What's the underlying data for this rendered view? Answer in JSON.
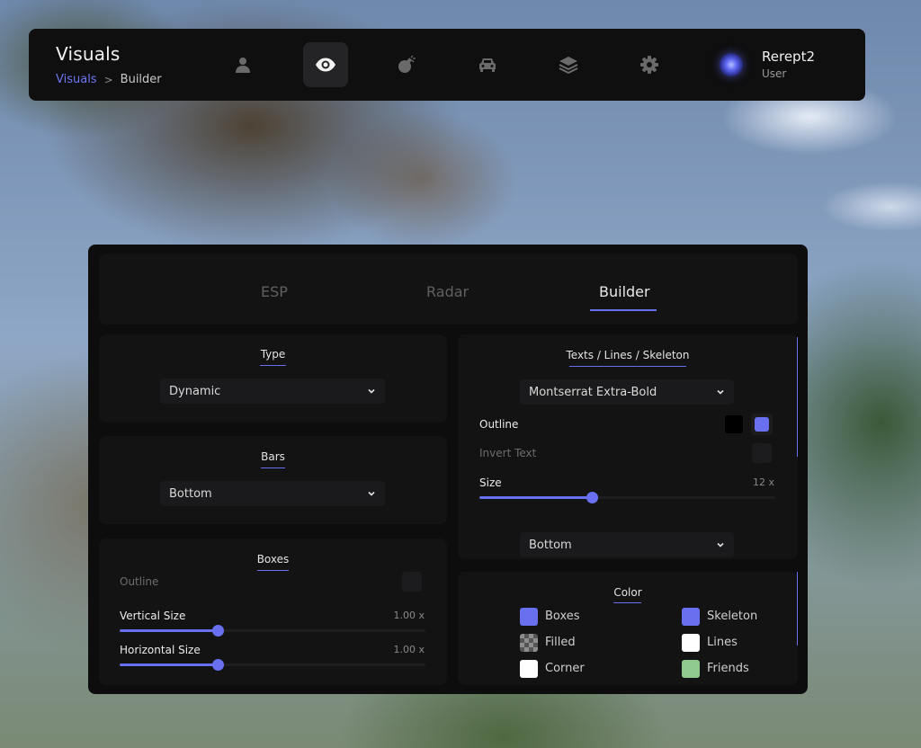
{
  "header": {
    "title": "Visuals",
    "breadcrumb": {
      "parent": "Visuals",
      "separator": ">",
      "current": "Builder"
    },
    "nav": [
      {
        "icon": "user-icon",
        "active": false
      },
      {
        "icon": "eye-icon",
        "active": true
      },
      {
        "icon": "bomb-icon",
        "active": false
      },
      {
        "icon": "car-icon",
        "active": false
      },
      {
        "icon": "layers-icon",
        "active": false
      },
      {
        "icon": "gear-icon",
        "active": false
      }
    ],
    "user": {
      "name": "Rerept2",
      "role": "User"
    }
  },
  "tabs": [
    {
      "label": "ESP",
      "active": false
    },
    {
      "label": "Radar",
      "active": false
    },
    {
      "label": "Builder",
      "active": true
    }
  ],
  "accent_color": "#6870f0",
  "type_card": {
    "title": "Type",
    "value": "Dynamic"
  },
  "bars_card": {
    "title": "Bars",
    "value": "Bottom"
  },
  "boxes_card": {
    "title": "Boxes",
    "outline_label": "Outline",
    "outline_enabled": false,
    "vertical_label": "Vertical Size",
    "vertical_value": "1.00 x",
    "vertical_fraction": 0.32,
    "horizontal_label": "Horizontal Size",
    "horizontal_value": "1.00 x",
    "horizontal_fraction": 0.32
  },
  "texts_card": {
    "title": "Texts / Lines / Skeleton",
    "font": "Montserrat Extra-Bold",
    "outline_label": "Outline",
    "outline_colors": [
      "#000000",
      "#6870f0"
    ],
    "invert_label": "Invert Text",
    "invert_enabled": false,
    "size_label": "Size",
    "size_value": "12 x",
    "size_fraction": 0.38,
    "position": "Bottom"
  },
  "color_card": {
    "title": "Color",
    "items": [
      {
        "label": "Boxes",
        "color": "#6870f0"
      },
      {
        "label": "Skeleton",
        "color": "#6870f0"
      },
      {
        "label": "Filled",
        "color": "checker"
      },
      {
        "label": "Lines",
        "color": "#ffffff"
      },
      {
        "label": "Corner",
        "color": "#ffffff"
      },
      {
        "label": "Friends",
        "color": "#8fc98f"
      }
    ]
  }
}
